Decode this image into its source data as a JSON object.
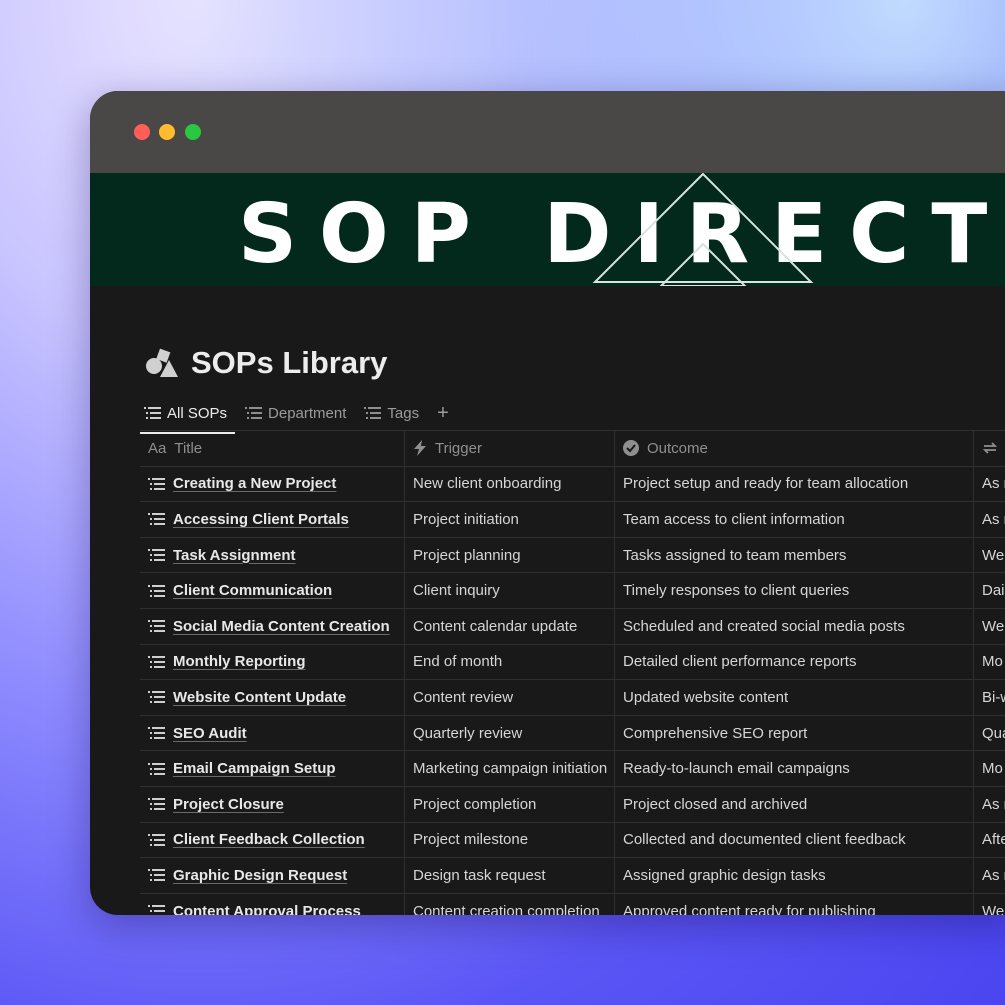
{
  "banner": {
    "text": "SOP DIRECTO"
  },
  "page": {
    "title": "SOPs Library"
  },
  "views": {
    "tabs": [
      "All SOPs",
      "Department",
      "Tags"
    ],
    "add_label": "+"
  },
  "table": {
    "headers": [
      "Title",
      "Trigger",
      "Outcome",
      ""
    ],
    "title_header_prefix": "Aa",
    "rows": [
      {
        "title": "Creating a New Project",
        "trigger": "New client onboarding",
        "outcome": "Project setup and ready for team allocation",
        "freq": "As n"
      },
      {
        "title": "Accessing Client Portals",
        "trigger": "Project initiation",
        "outcome": "Team access to client information",
        "freq": "As n"
      },
      {
        "title": "Task Assignment",
        "trigger": "Project planning",
        "outcome": "Tasks assigned to team members",
        "freq": "Wee"
      },
      {
        "title": "Client Communication",
        "trigger": "Client inquiry",
        "outcome": "Timely responses to client queries",
        "freq": "Dail"
      },
      {
        "title": "Social Media Content Creation",
        "trigger": "Content calendar update",
        "outcome": "Scheduled and created social media posts",
        "freq": "Wee"
      },
      {
        "title": "Monthly Reporting",
        "trigger": "End of month",
        "outcome": "Detailed client performance reports",
        "freq": "Mo"
      },
      {
        "title": "Website Content Update",
        "trigger": "Content review",
        "outcome": "Updated website content",
        "freq": "Bi-w"
      },
      {
        "title": "SEO Audit",
        "trigger": "Quarterly review",
        "outcome": "Comprehensive SEO report",
        "freq": "Qua"
      },
      {
        "title": "Email Campaign Setup",
        "trigger": "Marketing campaign initiation",
        "outcome": "Ready-to-launch email campaigns",
        "freq": "Mo"
      },
      {
        "title": "Project Closure",
        "trigger": "Project completion",
        "outcome": "Project closed and archived",
        "freq": "As n"
      },
      {
        "title": "Client Feedback Collection",
        "trigger": "Project milestone",
        "outcome": "Collected and documented client feedback",
        "freq": "Afte"
      },
      {
        "title": "Graphic Design Request",
        "trigger": "Design task request",
        "outcome": "Assigned graphic design tasks",
        "freq": "As n"
      },
      {
        "title": "Content Approval Process",
        "trigger": "Content creation completion",
        "outcome": "Approved content ready for publishing",
        "freq": "Wee"
      }
    ]
  },
  "colors": {
    "window_bg": "#191919",
    "titlebar": "#4a4747",
    "banner_bg": "#02291b",
    "accent_bg": "#5a55f5"
  },
  "icons": {
    "window_controls": [
      "close-dot",
      "minimize-dot",
      "maximize-dot"
    ],
    "page_icon": "shapes-icon",
    "view_icon": "list-icon",
    "trigger_header": "lightning-icon",
    "outcome_header": "check-circle-icon",
    "frequency_header": "repeat-icon",
    "row_icon": "list-icon"
  }
}
